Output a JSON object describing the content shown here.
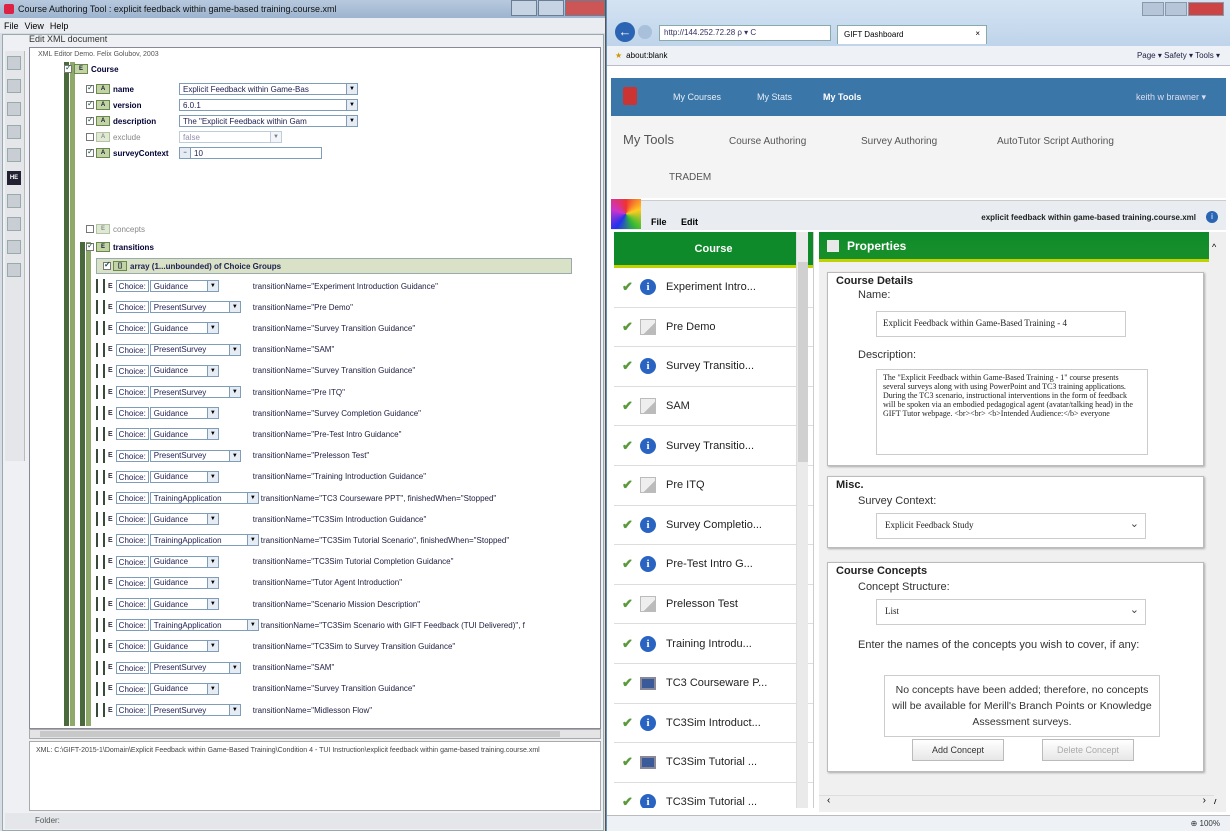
{
  "left_window": {
    "title": "Course Authoring Tool : explicit feedback within game-based training.course.xml",
    "menu": [
      "File",
      "View",
      "Help"
    ],
    "edit_label": "Edit XML document",
    "demo_caption": "XML Editor Demo. Felix Golubov, 2003",
    "tree": {
      "course_label": "Course",
      "fields": [
        {
          "label": "name",
          "value": "Explicit Feedback within Game-Bas"
        },
        {
          "label": "version",
          "value": "6.0.1"
        },
        {
          "label": "description",
          "value": "The \"Explicit Feedback within Gam"
        },
        {
          "label": "exclude",
          "value": "false"
        },
        {
          "label": "surveyContext",
          "value": "10"
        }
      ],
      "concepts_label": "concepts",
      "transitions_label": "transitions",
      "array_label": "array (1...unbounded) of Choice Groups",
      "choice_prefix": "Choice:",
      "choices": [
        {
          "type": "Guidance",
          "text": "transitionName=\"Experiment Introduction Guidance\""
        },
        {
          "type": "PresentSurvey",
          "text": "transitionName=\"Pre Demo\""
        },
        {
          "type": "Guidance",
          "text": "transitionName=\"Survey Transition Guidance\""
        },
        {
          "type": "PresentSurvey",
          "text": "transitionName=\"SAM\""
        },
        {
          "type": "Guidance",
          "text": "transitionName=\"Survey Transition Guidance\""
        },
        {
          "type": "PresentSurvey",
          "text": "transitionName=\"Pre ITQ\""
        },
        {
          "type": "Guidance",
          "text": "transitionName=\"Survey Completion Guidance\""
        },
        {
          "type": "Guidance",
          "text": "transitionName=\"Pre-Test Intro Guidance\""
        },
        {
          "type": "PresentSurvey",
          "text": "transitionName=\"Prelesson Test\""
        },
        {
          "type": "Guidance",
          "text": "transitionName=\"Training Introduction Guidance\""
        },
        {
          "type": "TrainingApplication",
          "text": "transitionName=\"TC3 Courseware PPT\", finishedWhen=\"Stopped\""
        },
        {
          "type": "Guidance",
          "text": "transitionName=\"TC3Sim Introduction Guidance\""
        },
        {
          "type": "TrainingApplication",
          "text": "transitionName=\"TC3Sim Tutorial Scenario\", finishedWhen=\"Stopped\""
        },
        {
          "type": "Guidance",
          "text": "transitionName=\"TC3Sim Tutorial Completion Guidance\""
        },
        {
          "type": "Guidance",
          "text": "transitionName=\"Tutor Agent Introduction\""
        },
        {
          "type": "Guidance",
          "text": "transitionName=\"Scenario Mission Description\""
        },
        {
          "type": "TrainingApplication",
          "text": "transitionName=\"TC3Sim Scenario with GIFT Feedback (TUI Delivered)\", f"
        },
        {
          "type": "Guidance",
          "text": "transitionName=\"TC3Sim to Survey Transition Guidance\""
        },
        {
          "type": "PresentSurvey",
          "text": "transitionName=\"SAM\""
        },
        {
          "type": "Guidance",
          "text": "transitionName=\"Survey Transition Guidance\""
        },
        {
          "type": "PresentSurvey",
          "text": "transitionName=\"Midlesson Flow\""
        }
      ]
    },
    "info_text": "XML: C:\\GIFT-2015-1\\Domain\\Explicit Feedback within Game-Based Training\\Condition 4 - TUI Instruction\\explicit feedback within game-based training.course.xml",
    "status": "Folder:"
  },
  "right_window": {
    "address": "http://144.252.72.28",
    "address_icons": "ρ ▾ C",
    "tab_title": "GIFT Dashboard",
    "fav_item": "about:blank",
    "command_bar": "Page ▾  Safety ▾  Tools ▾",
    "nav": {
      "links": [
        "My Courses",
        "My Stats",
        "My Tools"
      ],
      "user": "keith w brawner ▾"
    },
    "tools": {
      "title": "My Tools",
      "links": [
        "Course Authoring",
        "Survey Authoring",
        "AutoTutor Script Authoring",
        "TRADEM"
      ]
    },
    "editor": {
      "menu": [
        "File",
        "Edit"
      ],
      "filename": "explicit feedback within game-based training.course.xml"
    },
    "course_panel": {
      "header": "Course",
      "items": [
        {
          "label": "Experiment Intro...",
          "icon": "info-icon"
        },
        {
          "label": "Pre Demo",
          "icon": "survey-icon"
        },
        {
          "label": "Survey Transitio...",
          "icon": "info-icon"
        },
        {
          "label": "SAM",
          "icon": "survey-icon"
        },
        {
          "label": "Survey Transitio...",
          "icon": "info-icon"
        },
        {
          "label": "Pre ITQ",
          "icon": "survey-icon"
        },
        {
          "label": "Survey Completio...",
          "icon": "info-icon"
        },
        {
          "label": "Pre-Test Intro G...",
          "icon": "info-icon"
        },
        {
          "label": "Prelesson Test",
          "icon": "survey-icon"
        },
        {
          "label": "Training Introdu...",
          "icon": "info-icon"
        },
        {
          "label": "TC3 Courseware P...",
          "icon": "monitor-icon"
        },
        {
          "label": "TC3Sim Introduct...",
          "icon": "info-icon"
        },
        {
          "label": "TC3Sim Tutorial ...",
          "icon": "monitor-icon"
        },
        {
          "label": "TC3Sim Tutorial ...",
          "icon": "info-icon"
        }
      ]
    },
    "properties": {
      "header": "Properties",
      "course_details": {
        "title": "Course Details",
        "name_label": "Name:",
        "name_value": "Explicit Feedback within Game-Based Training - 4",
        "desc_label": "Description:",
        "desc_value": "The \"Explicit Feedback within Game-Based Training - 1\" course presents several surveys along with using PowerPoint and TC3 training applications. During the TC3 scenario, instructional interventions in the form of feedback will be spoken via an embodied pedagogical agent (avatar/talking head) in the GIFT Tutor webpage. <br><br> <b>Intended Audience:</b> everyone"
      },
      "misc": {
        "title": "Misc.",
        "survey_label": "Survey Context:",
        "survey_value": "Explicit Feedback Study"
      },
      "concepts": {
        "title": "Course Concepts",
        "structure_label": "Concept Structure:",
        "structure_value": "List",
        "prompt": "Enter the names of the concepts you wish to cover, if any:",
        "empty_note": "No concepts have been added; therefore, no concepts will be available for Merill's Branch Points or Knowledge Assessment surveys.",
        "add_button": "Add Concept",
        "delete_button": "Delete Concept"
      }
    },
    "zoom": "100%"
  }
}
